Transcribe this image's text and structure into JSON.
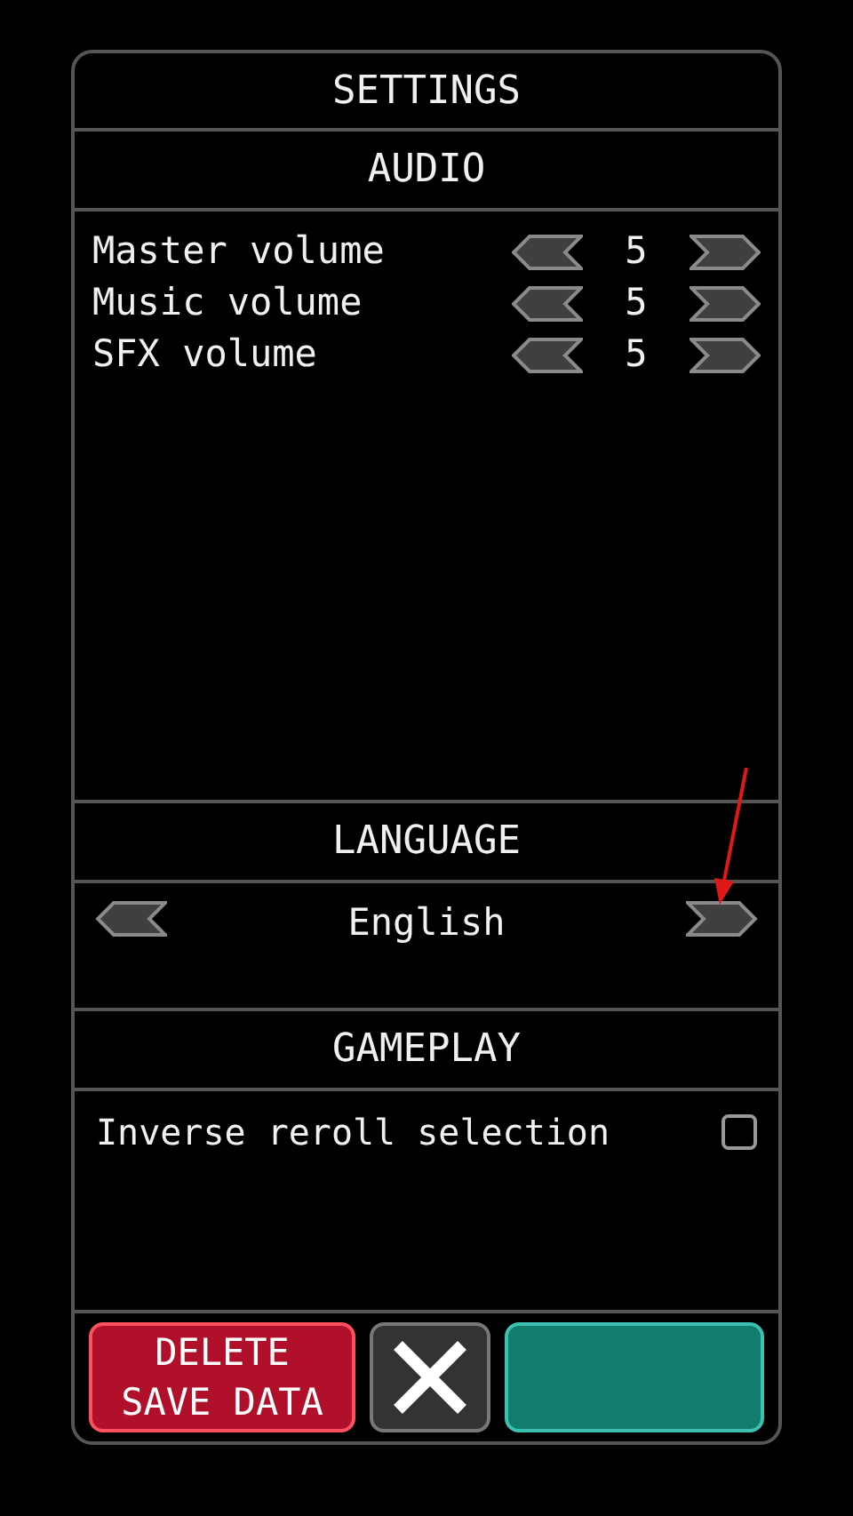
{
  "title": "SETTINGS",
  "audio": {
    "heading": "AUDIO",
    "rows": [
      {
        "label": "Master volume",
        "value": "5"
      },
      {
        "label": "Music volume",
        "value": "5"
      },
      {
        "label": "SFX volume",
        "value": "5"
      }
    ]
  },
  "language": {
    "heading": "LANGUAGE",
    "value": "English"
  },
  "gameplay": {
    "heading": "GAMEPLAY",
    "options": [
      {
        "label": "Inverse reroll selection",
        "checked": false
      }
    ]
  },
  "buttons": [
    {
      "kind": "danger",
      "lines": [
        "DELETE",
        "SAVE DATA"
      ]
    },
    {
      "kind": "close"
    },
    {
      "kind": "teal"
    }
  ]
}
